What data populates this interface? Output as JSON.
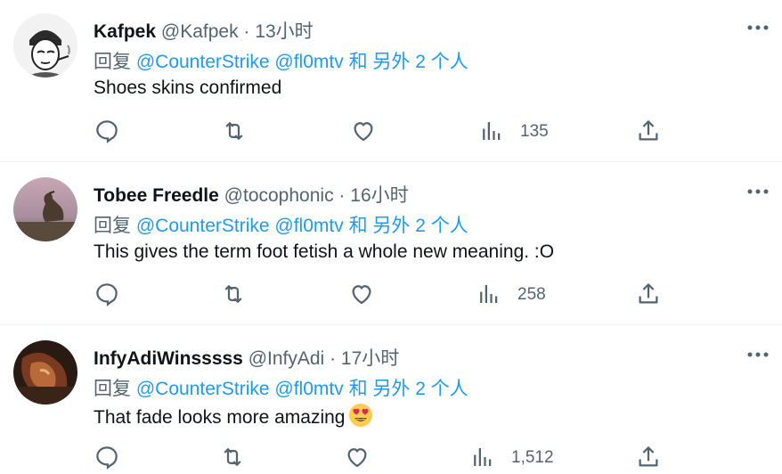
{
  "tweets": [
    {
      "name": "Kafpek",
      "handle": "@Kafpek",
      "dot": "·",
      "time": "13小时",
      "reply_prefix": "回复",
      "mentions": [
        "@CounterStrike",
        "@fl0mtv"
      ],
      "others": "和 另外 2 个人",
      "text": "Shoes skins confirmed",
      "views": "135"
    },
    {
      "name": "Tobee Freedle",
      "handle": "@tocophonic",
      "dot": "·",
      "time": "16小时",
      "reply_prefix": "回复",
      "mentions": [
        "@CounterStrike",
        "@fl0mtv"
      ],
      "others": "和 另外 2 个人",
      "text": "This gives the term foot fetish a whole new meaning. :O",
      "views": "258"
    },
    {
      "name": "InfyAdiWinsssss",
      "handle": "@InfyAdi",
      "dot": "·",
      "time": "17小时",
      "reply_prefix": "回复",
      "mentions": [
        "@CounterStrike",
        "@fl0mtv"
      ],
      "others": "和 另外 2 个人",
      "text": "That fade looks more amazing",
      "emoji": "heart-eyes-emoji",
      "views": "1,512"
    }
  ],
  "icons": {
    "more": "more-options-icon",
    "reply": "reply-icon",
    "retweet": "retweet-icon",
    "like": "like-icon",
    "views": "views-icon",
    "share": "share-icon"
  },
  "colors": {
    "text": "#0f1419",
    "secondary": "#536471",
    "link": "#1d9bf0",
    "divider": "#eff3f4"
  }
}
